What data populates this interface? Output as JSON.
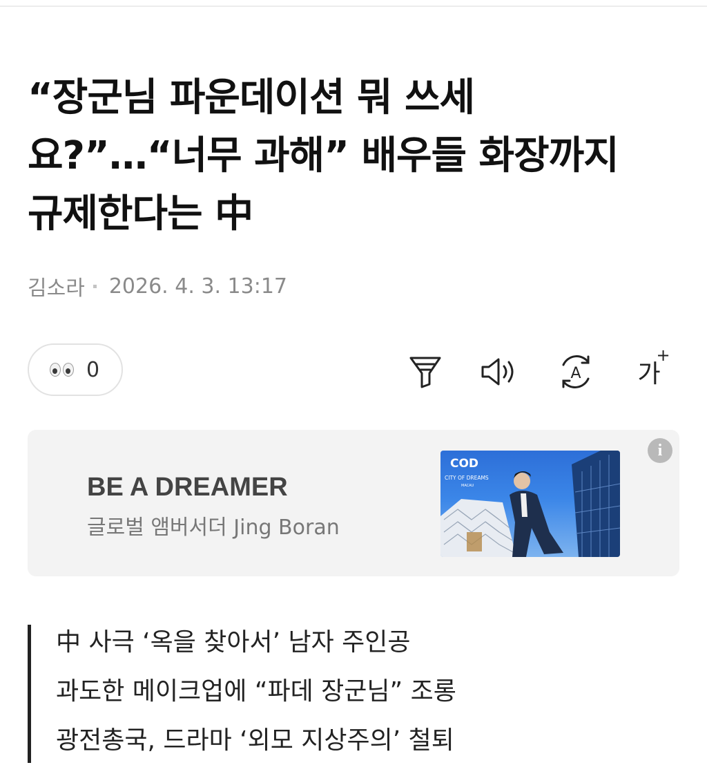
{
  "article": {
    "title_lines": [
      "“장군님 파운데이션 뭐 쓰세",
      "요?”…“너무 과해” 배우들 화장까지",
      "규제한다는 中"
    ],
    "author": "김소라",
    "date": "2026. 4. 3. 13:17"
  },
  "reaction": {
    "icon": "eyes-icon",
    "count": "0"
  },
  "toolbar": {
    "items": [
      {
        "name": "summary-filter-icon"
      },
      {
        "name": "speaker-icon"
      },
      {
        "name": "translate-icon",
        "letter": "A"
      },
      {
        "name": "font-size-icon",
        "label": "가",
        "superscript": "+"
      }
    ]
  },
  "ad": {
    "title": "BE A DREAMER",
    "subtitle": "글로벌 앰버서더 Jing Boran",
    "image_logo": "COD",
    "image_caption": "CITY OF DREAMS",
    "image_caption_sub": "MACAU",
    "info_icon": "i"
  },
  "summary": {
    "lines": [
      "中 사극 ‘옥을 찾아서’ 남자 주인공",
      "과도한 메이크업에 “파데 장군님” 조롱",
      "광전총국, 드라마 ‘외모 지상주의’ 철퇴"
    ]
  },
  "colors": {
    "text": "#111111",
    "meta": "#8a8a8a",
    "ad_background": "#f3f3f3"
  }
}
